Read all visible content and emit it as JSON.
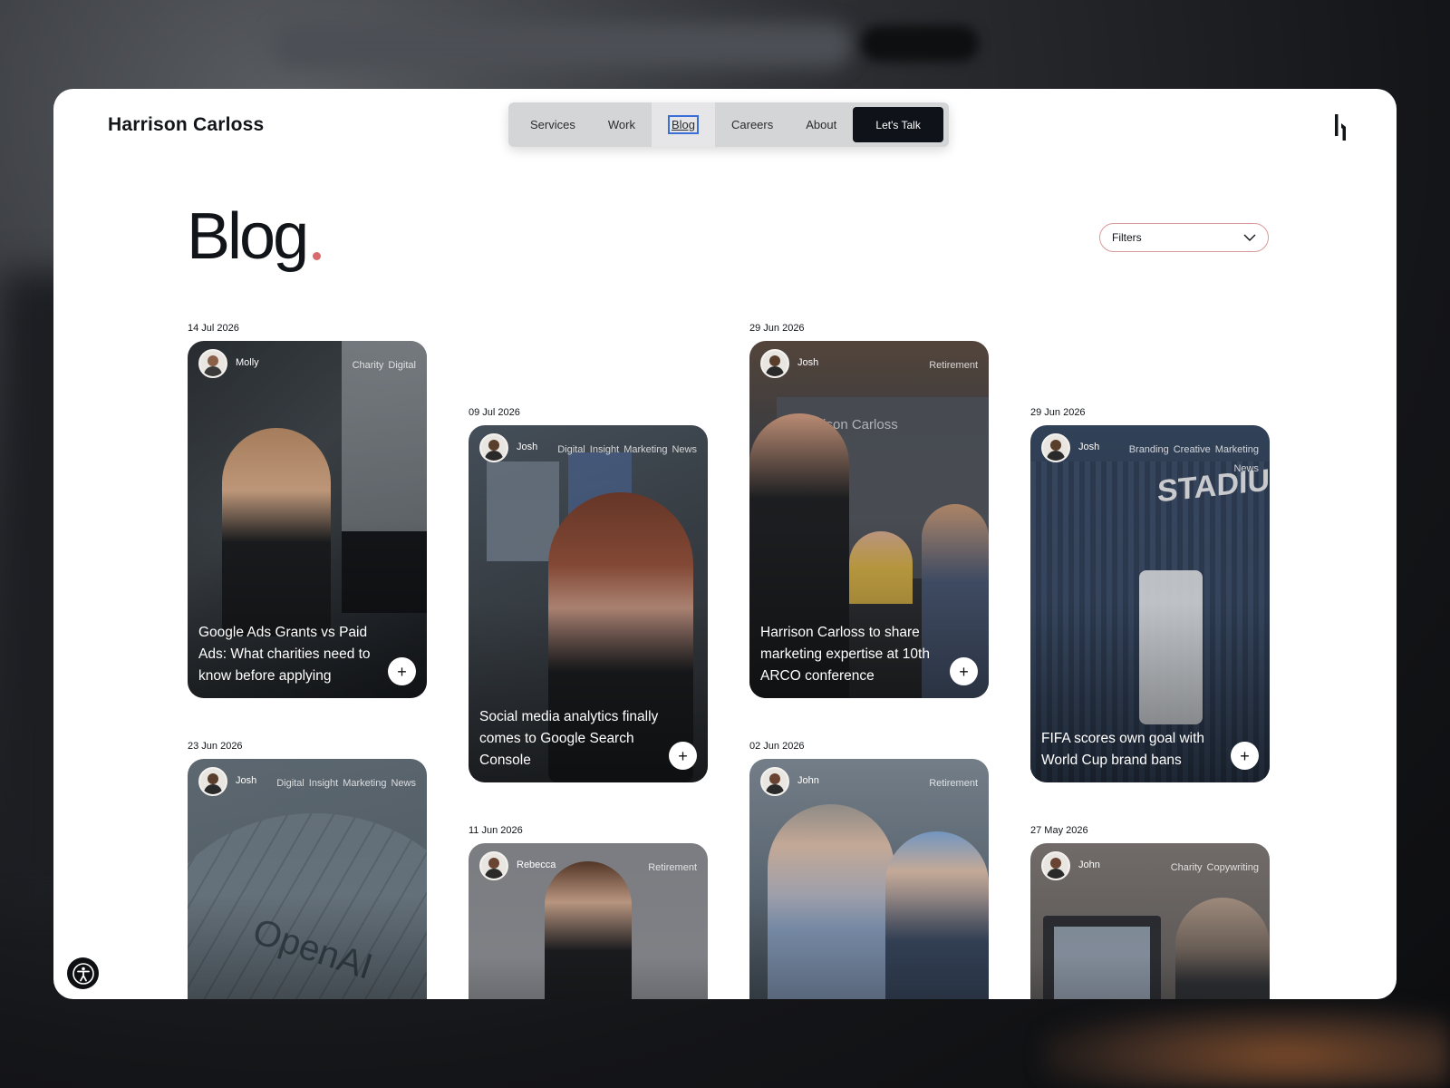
{
  "site": {
    "logo": "Harrison Carloss"
  },
  "nav": {
    "items": [
      "Services",
      "Work",
      "Blog",
      "Careers",
      "About"
    ],
    "active": "Blog",
    "cta": "Let's Talk"
  },
  "page": {
    "title": "Blog",
    "accent": "#d9696a"
  },
  "filters": {
    "label": "Filters"
  },
  "posts": [
    {
      "date": "14 Jul 2026",
      "author": "Molly",
      "tags": [
        "Charity",
        "Digital"
      ],
      "title": "Google Ads Grants vs Paid Ads: What charities need to know before applying"
    },
    {
      "date": "09 Jul 2026",
      "author": "Josh",
      "tags": [
        "Digital",
        "Insight",
        "Marketing",
        "News"
      ],
      "title": "Social media analytics finally comes to Google Search Console"
    },
    {
      "date": "29 Jun 2026",
      "author": "Josh",
      "tags": [
        "Retirement"
      ],
      "title": "Harrison Carloss to share marketing expertise at 10th ARCO conference"
    },
    {
      "date": "29 Jun 2026",
      "author": "Josh",
      "tags": [
        "Branding",
        "Creative",
        "Marketing",
        "News"
      ],
      "title": "FIFA scores own goal with World Cup brand bans"
    },
    {
      "date": "23 Jun 2026",
      "author": "Josh",
      "tags": [
        "Digital",
        "Insight",
        "Marketing",
        "News"
      ],
      "title": ""
    },
    {
      "date": "11 Jun 2026",
      "author": "Rebecca",
      "tags": [
        "Retirement"
      ],
      "title": ""
    },
    {
      "date": "02 Jun 2026",
      "author": "John",
      "tags": [
        "Retirement"
      ],
      "title": ""
    },
    {
      "date": "27 May 2026",
      "author": "John",
      "tags": [
        "Charity",
        "Copywriting"
      ],
      "title": ""
    }
  ]
}
